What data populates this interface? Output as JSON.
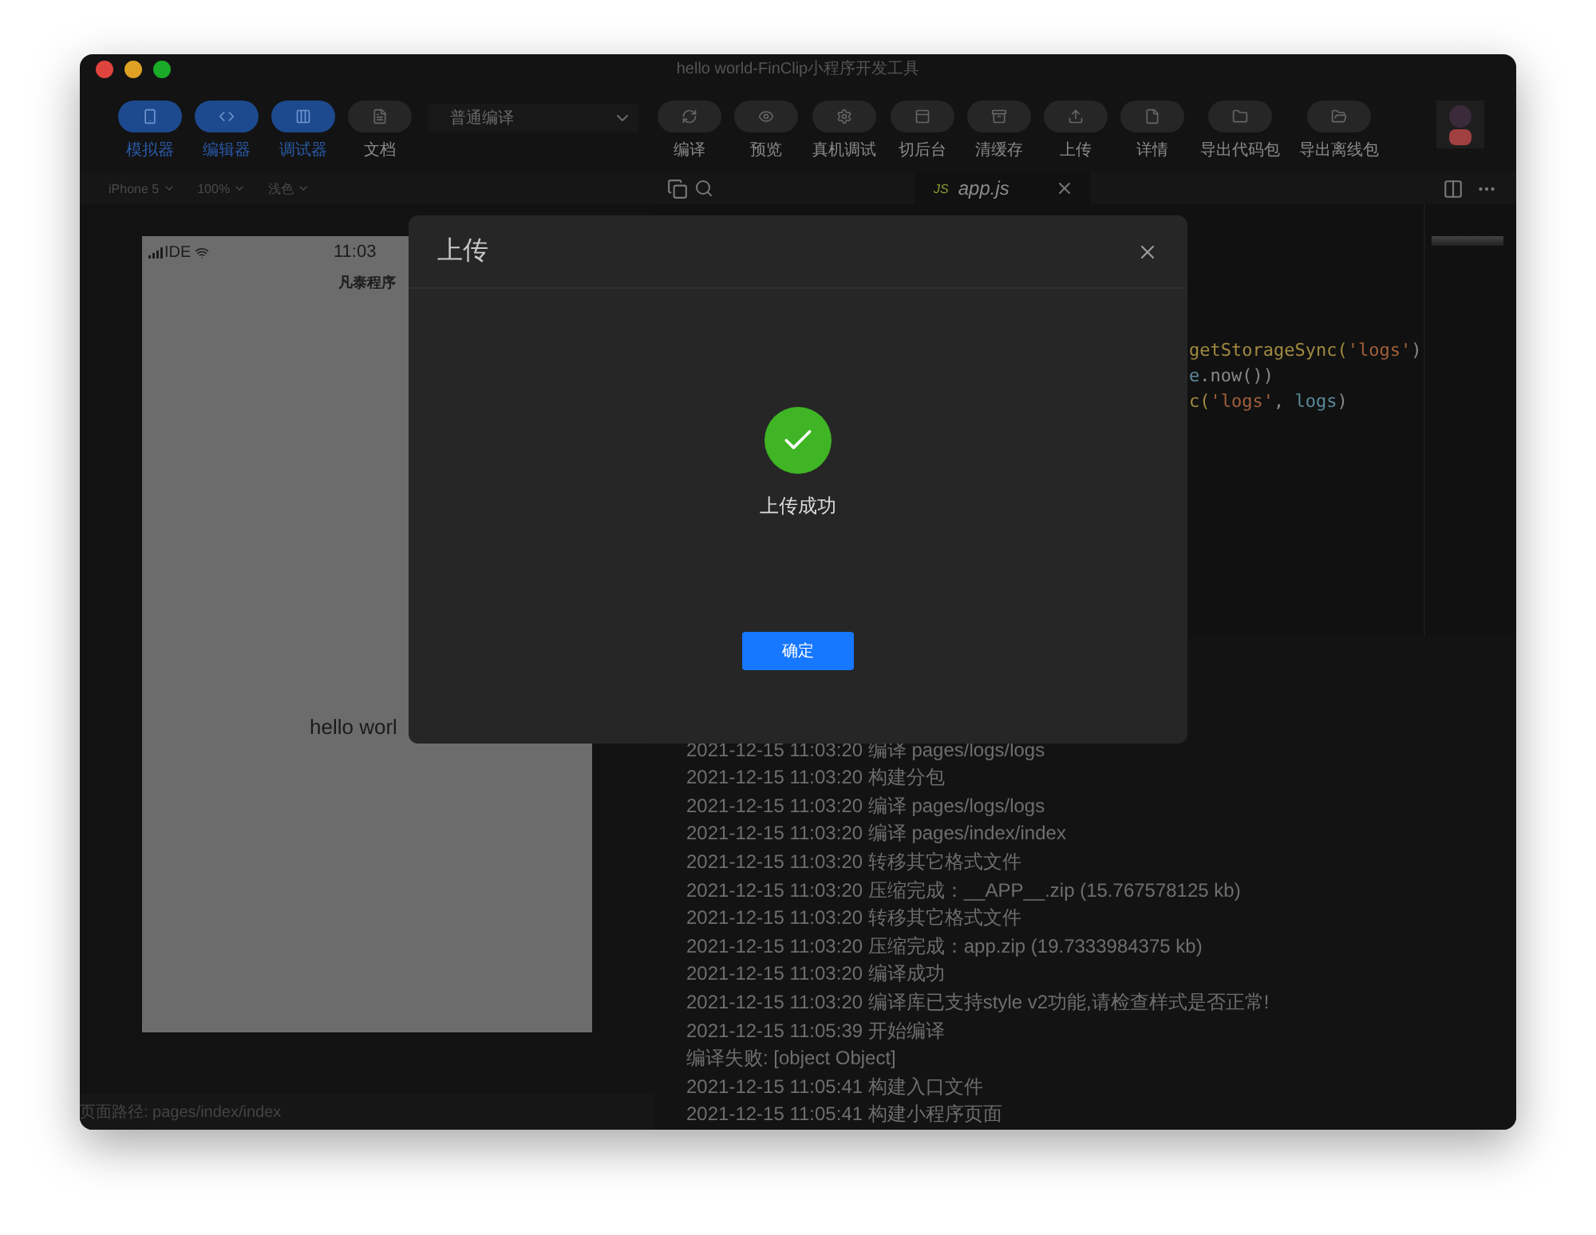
{
  "window": {
    "title": "hello world-FinClip小程序开发工具"
  },
  "toolbar": {
    "view_toggles": [
      {
        "label": "模拟器",
        "on": true
      },
      {
        "label": "编辑器",
        "on": true
      },
      {
        "label": "调试器",
        "on": true
      },
      {
        "label": "文档",
        "on": false
      }
    ],
    "compile_mode": "普通编译",
    "actions": [
      "编译",
      "预览",
      "真机调试",
      "切后台",
      "清缓存",
      "上传",
      "详情",
      "导出代码包",
      "导出离线包"
    ]
  },
  "simulator_bar": [
    "iPhone 5",
    "100%",
    "浅色"
  ],
  "editor_tab": {
    "badge": "JS",
    "label": "app.js"
  },
  "code_lines": [
    [
      {
        "kind": "fn",
        "text": "getStorageSync("
      },
      {
        "kind": "str",
        "text": "'logs'"
      },
      {
        "kind": "punct",
        "text": ")"
      }
    ],
    [
      {
        "kind": "var",
        "text": "e"
      },
      {
        "kind": "punct",
        "text": ".now())"
      }
    ],
    [
      {
        "kind": "fn",
        "text": "c("
      },
      {
        "kind": "str",
        "text": "'logs'"
      },
      {
        "kind": "punct",
        "text": ", "
      },
      {
        "kind": "var",
        "text": "logs"
      },
      {
        "kind": "punct",
        "text": ")"
      }
    ]
  ],
  "phone": {
    "carrier": "IDE",
    "time": "11:03",
    "nav_title": "凡泰程序",
    "body_text": "hello worl"
  },
  "footer": "页面路径: pages/index/index",
  "console": [
    "2021-12-15 11:03:20 编译 pages/logs/logs",
    "2021-12-15 11:03:20 构建分包",
    "2021-12-15 11:03:20 编译 pages/logs/logs",
    "2021-12-15 11:03:20 编译 pages/index/index",
    "2021-12-15 11:03:20 转移其它格式文件",
    "2021-12-15 11:03:20 压缩完成：__APP__.zip (15.767578125 kb)",
    "2021-12-15 11:03:20 转移其它格式文件",
    "2021-12-15 11:03:20 压缩完成：app.zip (19.7333984375 kb)",
    "2021-12-15 11:03:20 编译成功",
    "2021-12-15 11:03:20 编译库已支持style v2功能,请检查样式是否正常!",
    "2021-12-15 11:05:39 开始编译",
    "编译失败: [object Object]",
    "2021-12-15 11:05:41 构建入口文件",
    "2021-12-15 11:05:41 构建小程序页面"
  ],
  "modal": {
    "title": "上传",
    "message": "上传成功",
    "confirm": "确定"
  }
}
